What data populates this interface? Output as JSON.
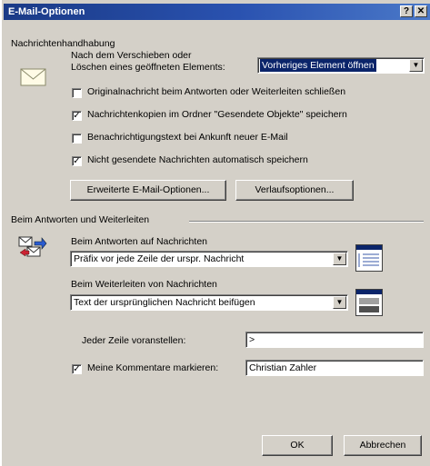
{
  "window": {
    "title": "E-Mail-Optionen",
    "help_button": "?",
    "close_button": "✕"
  },
  "handling": {
    "group_title": "Nachrichtenhandhabung",
    "move_label_line1": "Nach dem Verschieben oder",
    "move_label_line2": "Löschen eines geöffneten Elements:",
    "move_select_value": "Vorheriges Element öffnen",
    "checkboxes": [
      {
        "label": "Originalnachricht beim Antworten oder Weiterleiten schließen",
        "checked": false
      },
      {
        "label": "Nachrichtenkopien im Ordner \"Gesendete Objekte\" speichern",
        "checked": true
      },
      {
        "label": "Benachrichtigungstext bei Ankunft neuer E-Mail",
        "checked": false
      },
      {
        "label": "Nicht gesendete Nachrichten automatisch speichern",
        "checked": true
      }
    ],
    "advanced_button": "Erweiterte E-Mail-Optionen...",
    "tracking_button": "Verlaufsoptionen..."
  },
  "reply": {
    "group_title": "Beim Antworten und Weiterleiten",
    "reply_label": "Beim Antworten auf Nachrichten",
    "reply_select_value": "Präfix vor jede Zeile der urspr. Nachricht",
    "forward_label": "Beim Weiterleiten von Nachrichten",
    "forward_select_value": "Text der ursprünglichen Nachricht beifügen",
    "prefix_label": "Jeder Zeile voranstellen:",
    "prefix_value": ">",
    "mark_comments_label": "Meine Kommentare markieren:",
    "mark_comments_checked": true,
    "mark_comments_value": "Christian Zahler"
  },
  "footer": {
    "ok_label": "OK",
    "cancel_label": "Abbrechen"
  },
  "colors": {
    "title_bar": "#1a3a86",
    "dialog_face": "#d4d0c8",
    "selection": "#0a246a"
  }
}
